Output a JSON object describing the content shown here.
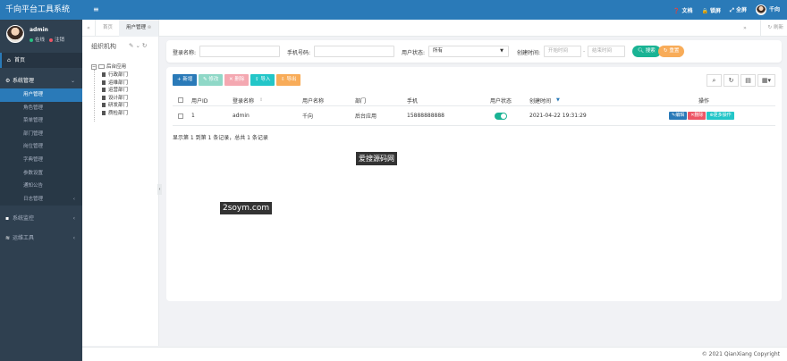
{
  "app": {
    "title": "千向平台工具系统"
  },
  "user": {
    "name": "admin",
    "status_online": "在线",
    "logout": "注销",
    "display_name": "千向"
  },
  "topbar": {
    "menu_icon": "≡",
    "docs": "文档",
    "lock": "锁屏",
    "fullscreen": "全屏"
  },
  "sidebar": {
    "home": "首页",
    "system": "系统管理",
    "sub_items": [
      "用户管理",
      "角色管理",
      "菜单管理",
      "部门管理",
      "岗位管理",
      "字典管理",
      "参数设置",
      "通知公告",
      "日志管理"
    ],
    "monitor": "系统监控",
    "ops": "运维工具"
  },
  "tabs": {
    "home": "首页",
    "active": "用户管理",
    "refresh": "刷新"
  },
  "tree": {
    "title": "组织机构",
    "root": "后台应用",
    "children": [
      "行政部门",
      "运维部门",
      "运营部门",
      "设计部门",
      "研发部门",
      "质检部门"
    ]
  },
  "search": {
    "login_name_label": "登录名称:",
    "phone_label": "手机号码:",
    "status_label": "用户状态:",
    "status_value": "所有",
    "created_label": "创建时间:",
    "start_placeholder": "开始时间",
    "dash": "-",
    "end_placeholder": "结束时间",
    "search_btn": "搜索",
    "reset_btn": "重置"
  },
  "toolbar": {
    "add": "新增",
    "edit": "修改",
    "delete": "删除",
    "import": "导入",
    "export": "导出"
  },
  "table": {
    "headers": {
      "id": "用户ID",
      "login": "登录名称",
      "name": "用户名称",
      "dept": "部门",
      "phone": "手机",
      "status": "用户状态",
      "created": "创建时间",
      "ops": "操作"
    },
    "rows": [
      {
        "id": "1",
        "login": "admin",
        "name": "千向",
        "dept": "后台应用",
        "phone": "15888888888",
        "status_on": true,
        "created": "2021-04-22 19:31:29"
      }
    ],
    "op_edit": "编辑",
    "op_delete": "删除",
    "op_more": "更多操作",
    "page_info": "显示第 1 到第 1 条记录，总共 1 条记录"
  },
  "watermarks": {
    "a": "爱搜源码网",
    "b": "2soym.com"
  },
  "footer": {
    "copyright": "© 2021 QianXiang Copyright"
  },
  "colors": {
    "primary": "#2a7ab8",
    "sidebar": "#2f4050",
    "green": "#1ab394",
    "orange": "#f8ac59",
    "red": "#ed5565",
    "cyan": "#23c6c8"
  }
}
